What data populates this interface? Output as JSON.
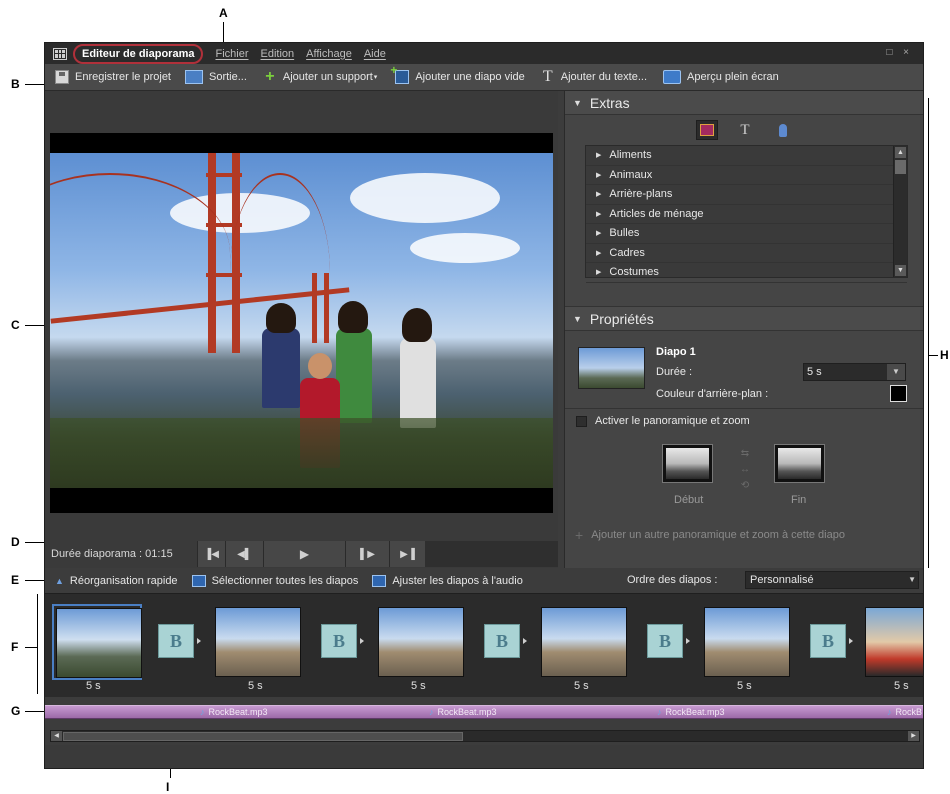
{
  "callouts": {
    "a": "A",
    "b": "B",
    "c": "C",
    "d": "D",
    "e": "E",
    "f": "F",
    "g": "G",
    "h": "H",
    "i": "I"
  },
  "menubar": {
    "app_title": "Editeur de diaporama",
    "items": [
      "Fichier",
      "Edition",
      "Affichage",
      "Aide"
    ],
    "window_controls": "□ ×"
  },
  "toolbar": {
    "save": "Enregistrer le projet",
    "output": "Sortie...",
    "add_media": "Ajouter un support",
    "add_blank": "Ajouter une diapo vide",
    "add_text": "Ajouter du texte...",
    "fullscreen": "Aperçu plein écran"
  },
  "preview": {
    "duration": "Durée diaporama : 01:15",
    "controls": [
      "first-icon",
      "prev-frame-icon",
      "play-icon",
      "next-frame-icon",
      "last-icon"
    ]
  },
  "extras": {
    "title": "Extras",
    "categories": [
      "Aliments",
      "Animaux",
      "Arrière-plans",
      "Articles de ménage",
      "Bulles",
      "Cadres",
      "Costumes"
    ]
  },
  "properties": {
    "title": "Propriétés",
    "slide_name": "Diapo 1",
    "duration_label": "Durée :",
    "duration_value": "5 s",
    "bg_color_label": "Couleur d'arrière-plan :",
    "bg_color": "#000000",
    "panzoom_label": "Activer le panoramique et zoom",
    "start_label": "Début",
    "end_label": "Fin",
    "add_panzoom": "Ajouter un autre panoramique et zoom à cette diapo"
  },
  "organize": {
    "quick_reorder": "Réorganisation rapide",
    "select_all": "Sélectionner toutes les diapos",
    "fit_audio": "Ajuster les diapos à l'audio",
    "order_label": "Ordre des diapos :",
    "order_value": "Personnalisé"
  },
  "filmstrip": {
    "slide_durations": [
      "5 s",
      "5 s",
      "5 s",
      "5 s",
      "5 s",
      "5 s"
    ],
    "transition_label": "B"
  },
  "audio": {
    "clips": [
      "RockBeat.mp3",
      "RockBeat.mp3",
      "RockBeat.mp3",
      "RockB"
    ]
  }
}
